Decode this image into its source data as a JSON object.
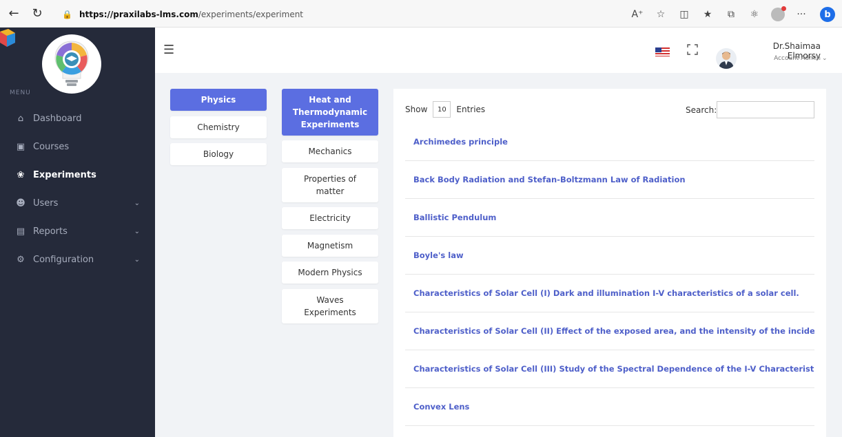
{
  "browser": {
    "url_host": "https://praxilabs-lms.com",
    "url_path": "/experiments/experiment",
    "menu_dots": "···",
    "bing_label": "b"
  },
  "sidebar": {
    "menu_label": "MENU",
    "items": [
      {
        "label": "Dashboard",
        "icon": "home-icon",
        "active": false,
        "has_submenu": false
      },
      {
        "label": "Courses",
        "icon": "book-icon",
        "active": false,
        "has_submenu": false
      },
      {
        "label": "Experiments",
        "icon": "atom-icon",
        "active": true,
        "has_submenu": false
      },
      {
        "label": "Users",
        "icon": "users-icon",
        "active": false,
        "has_submenu": true
      },
      {
        "label": "Reports",
        "icon": "report-icon",
        "active": false,
        "has_submenu": true
      },
      {
        "label": "Configuration",
        "icon": "gear-icon",
        "active": false,
        "has_submenu": true
      }
    ]
  },
  "header": {
    "user_name": "Dr.Shaimaa Elmorsy",
    "user_role": "Account Admin"
  },
  "categories": [
    {
      "label": "Physics",
      "active": true
    },
    {
      "label": "Chemistry",
      "active": false
    },
    {
      "label": "Biology",
      "active": false
    }
  ],
  "subcategories": [
    {
      "label": "Heat and Thermodynamic Experiments",
      "active": true
    },
    {
      "label": "Mechanics",
      "active": false
    },
    {
      "label": "Properties of matter",
      "active": false
    },
    {
      "label": "Electricity",
      "active": false
    },
    {
      "label": "Magnetism",
      "active": false
    },
    {
      "label": "Modern Physics",
      "active": false
    },
    {
      "label": "Waves Experiments",
      "active": false
    }
  ],
  "table": {
    "show_label": "Show",
    "entries_value": "10",
    "entries_label": "Entries",
    "search_label": "Search:",
    "search_value": "",
    "rows": [
      "Archimedes principle",
      "Back Body Radiation and Stefan-Boltzmann Law of Radiation",
      "Ballistic Pendulum",
      "Boyle's law",
      "Characteristics of Solar Cell (I) Dark and illumination I-V characteristics of a solar cell.",
      "Characteristics of Solar Cell (II) Effect of the exposed area, and the intensity of the incident light on",
      "Characteristics of Solar Cell (III) Study of the Spectral Dependence of the I-V Characteristics as well",
      "Convex Lens"
    ]
  },
  "colors": {
    "accent": "#5b6ee1",
    "link": "#4e5fc9",
    "sidebar_bg": "#252a3a"
  }
}
